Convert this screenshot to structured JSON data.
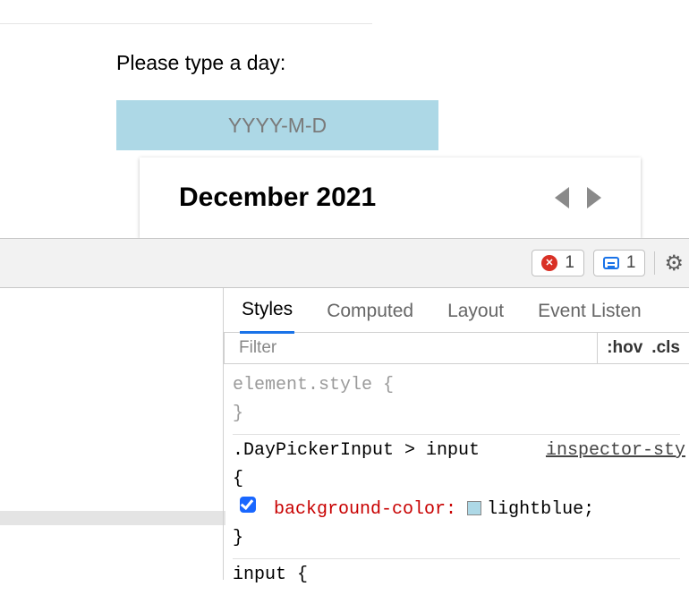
{
  "app": {
    "prompt": "Please type a day:",
    "input_placeholder": "YYYY-M-D",
    "picker_month": "December 2021"
  },
  "devtools": {
    "toolbar": {
      "error_count": "1",
      "message_count": "1"
    },
    "tabs": [
      "Styles",
      "Computed",
      "Layout",
      "Event Listen"
    ],
    "active_tab": 0,
    "filter_placeholder": "Filter",
    "toggles": {
      "hov": ":hov",
      "cls": ".cls"
    },
    "rules": {
      "element_style_selector": "element.style",
      "open_brace": "{",
      "close_brace": "}",
      "rule1": {
        "selector": ".DayPickerInput > input",
        "source": "inspector-sty",
        "prop": "background-color",
        "value": "lightblue",
        "checked": true
      },
      "rule2_selector": "input"
    }
  }
}
